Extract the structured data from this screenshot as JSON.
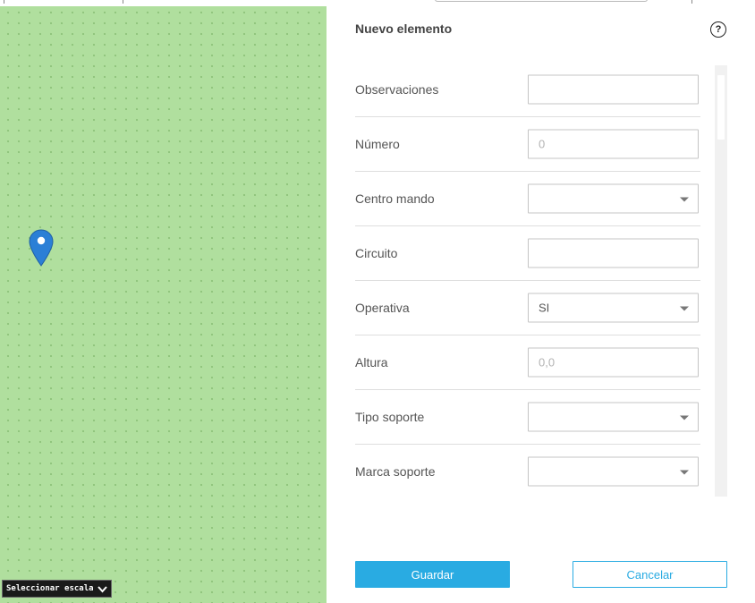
{
  "map": {
    "marker_icon": "map-pin-icon",
    "marker_color": "#2b7fd6",
    "scale_selector_label": "Seleccionar escala",
    "scale_selector_icon": "chevron-down-icon",
    "background_color": "#b0df9e"
  },
  "panel": {
    "title": "Nuevo elemento",
    "help_icon": "question-circle-icon",
    "help_glyph": "?",
    "fields": [
      {
        "label": "Observaciones",
        "type": "text",
        "value": "",
        "placeholder": ""
      },
      {
        "label": "Número",
        "type": "text",
        "value": "",
        "placeholder": "0"
      },
      {
        "label": "Centro mando",
        "type": "select",
        "value": ""
      },
      {
        "label": "Circuito",
        "type": "text",
        "value": "",
        "placeholder": ""
      },
      {
        "label": "Operativa",
        "type": "select",
        "value": "SI"
      },
      {
        "label": "Altura",
        "type": "text",
        "value": "",
        "placeholder": "0,0"
      },
      {
        "label": "Tipo soporte",
        "type": "select",
        "value": ""
      },
      {
        "label": "Marca soporte",
        "type": "select",
        "value": ""
      }
    ]
  },
  "actions": {
    "save_label": "Guardar",
    "cancel_label": "Cancelar",
    "accent_color": "#29abe2"
  }
}
